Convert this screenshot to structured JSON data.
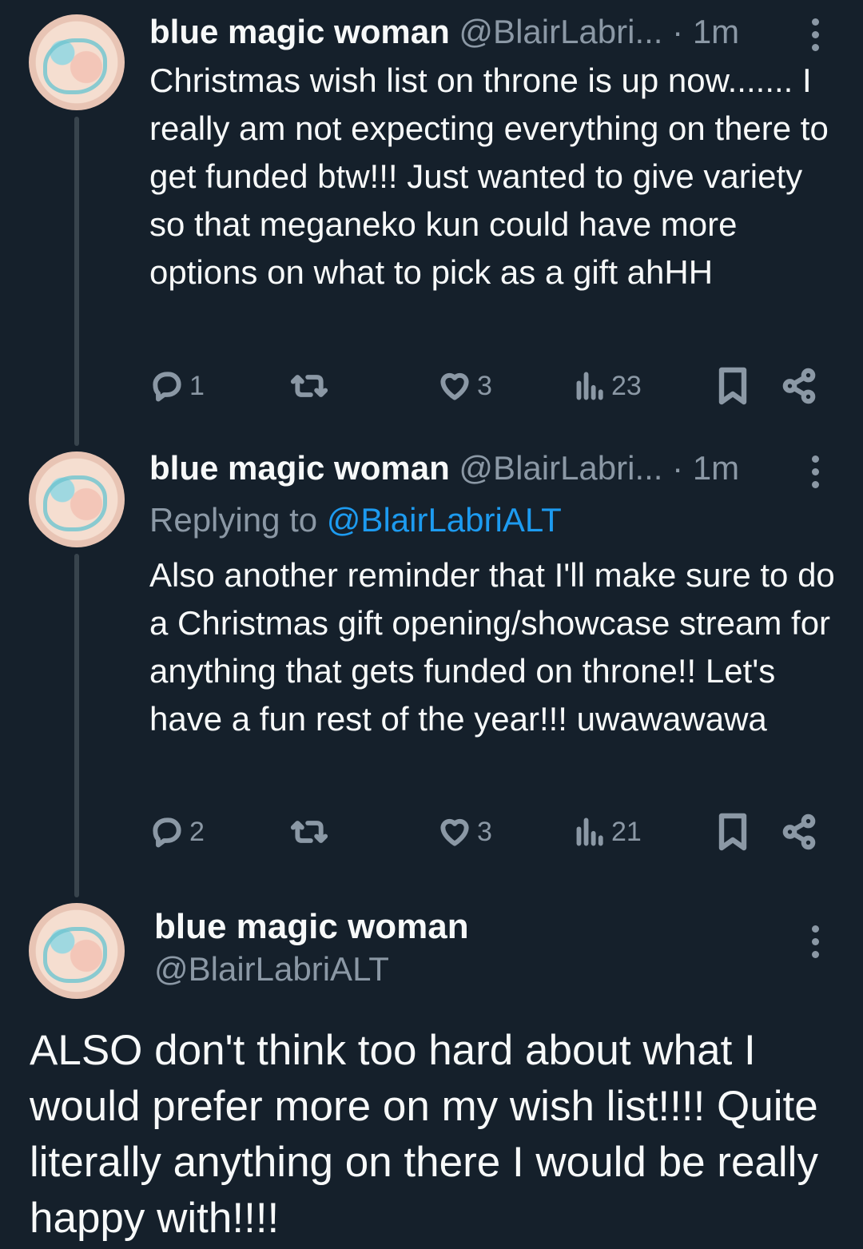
{
  "tweets": [
    {
      "name": "blue magic woman",
      "handle": "@BlairLabri...",
      "dot": "·",
      "time": "1m",
      "text": "Christmas wish list on throne is up now....... I really am not expecting everything on there to get funded btw!!! Just wanted to give variety so that meganeko kun could have more options on what to pick as a gift ahHH",
      "replies": "1",
      "likes": "3",
      "views": "23"
    },
    {
      "name": "blue magic woman",
      "handle": "@BlairLabri...",
      "dot": "·",
      "time": "1m",
      "replying_label": "Replying to",
      "replying_handle": "@BlairLabriALT",
      "text": "Also another reminder that I'll make sure to do a Christmas gift opening/showcase stream for anything that gets funded on throne!! Let's have a fun rest of the year!!! uwawawawa",
      "replies": "2",
      "likes": "3",
      "views": "21"
    }
  ],
  "main_tweet": {
    "name": "blue magic woman",
    "handle": "@BlairLabriALT",
    "text": "ALSO don't think too hard about what I would prefer more on my wish list!!!! Quite literally anything on there I would be really happy with!!!!"
  },
  "icons": {
    "reply": "reply-icon",
    "retweet": "retweet-icon",
    "like": "heart-icon",
    "views": "views-icon",
    "bookmark": "bookmark-icon",
    "share": "share-icon",
    "more": "more-vertical-icon"
  },
  "colors": {
    "background": "#15202b",
    "text": "#f7f9f9",
    "muted": "#8b98a5",
    "link": "#1d9bf0"
  }
}
